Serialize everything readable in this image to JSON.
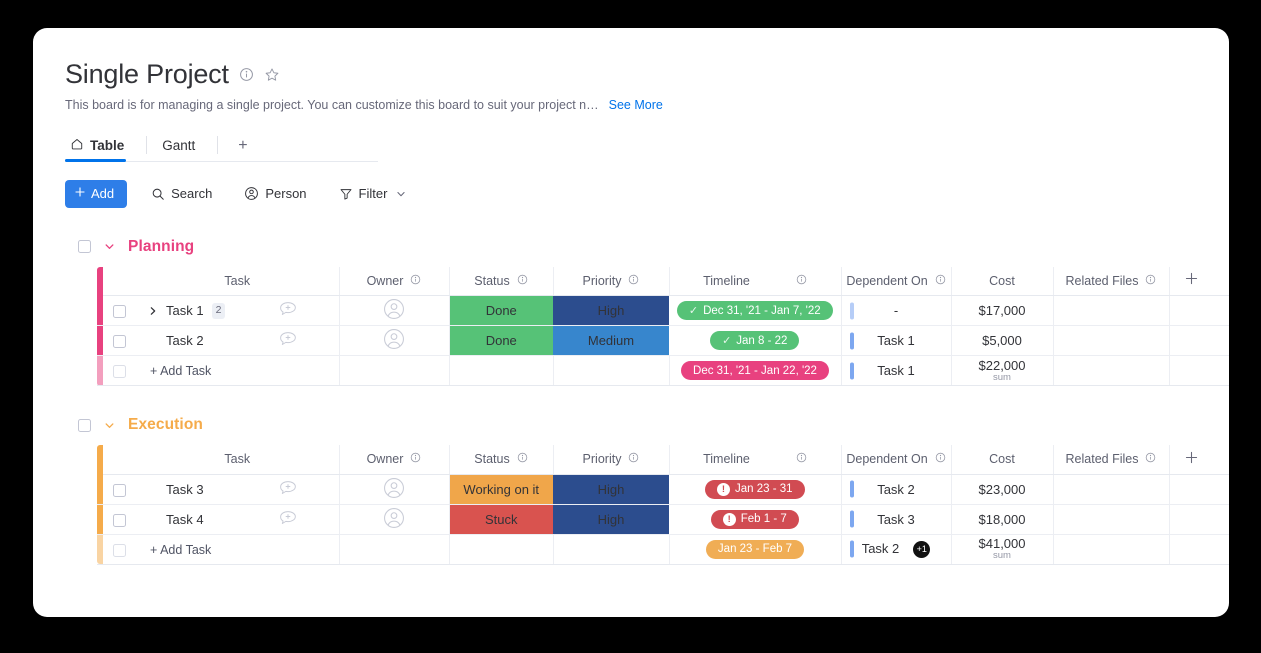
{
  "board": {
    "title": "Single Project",
    "description": "This board is for managing a single project. You can customize this board to suit your project n…",
    "see_more": "See More",
    "info_icon": "info-circle-icon",
    "star_icon": "star-outline-icon"
  },
  "tabs": {
    "items": [
      {
        "label": "Table",
        "icon": "home-icon",
        "active": true
      },
      {
        "label": "Gantt",
        "icon": "",
        "active": false
      }
    ],
    "add_label": "+"
  },
  "toolbar": {
    "add_label": "Add",
    "add_icon": "plus-icon",
    "search_label": "Search",
    "search_icon": "search-icon",
    "person_label": "Person",
    "person_icon": "person-icon",
    "filter_label": "Filter",
    "filter_icon": "funnel-icon",
    "chevron_icon": "chevron-down-icon"
  },
  "columns": [
    {
      "key": "task",
      "label": "Task",
      "info": false
    },
    {
      "key": "owner",
      "label": "Owner",
      "info": true
    },
    {
      "key": "status",
      "label": "Status",
      "info": true
    },
    {
      "key": "priority",
      "label": "Priority",
      "info": true
    },
    {
      "key": "timeline",
      "label": "Timeline",
      "info": true
    },
    {
      "key": "dependent",
      "label": "Dependent On",
      "info": true
    },
    {
      "key": "cost",
      "label": "Cost",
      "info": false
    },
    {
      "key": "files",
      "label": "Related Files",
      "info": true
    }
  ],
  "colors": {
    "accent_blue": "#0073ea",
    "add_button": "#2e7ee8",
    "group_planning": "#e8417f",
    "group_execution": "#f5ab4a",
    "status_done": "#56c277",
    "status_working": "#f0a64a",
    "status_stuck": "#d9534f",
    "priority_high": "#2c4d8e",
    "priority_medium": "#3786cd",
    "timeline_green": "#56c277",
    "timeline_pink": "#e8417f",
    "timeline_red": "#d14b52",
    "timeline_orange": "#f0ad55",
    "dep_bar_light": "#b6cdf7",
    "dep_bar_solid": "#7da7f0"
  },
  "groups": [
    {
      "name": "Planning",
      "color": "#e8417f",
      "caret_icon": "chevron-down-icon",
      "rows": [
        {
          "task": "Task 1",
          "expandable": true,
          "subitem_count": "2",
          "owner_icon": "avatar-placeholder-icon",
          "comment_icon": "comment-add-icon",
          "status": {
            "label": "Done",
            "color": "#56c277"
          },
          "priority": {
            "label": "High",
            "color": "#2c4d8e"
          },
          "timeline": {
            "label": "Dec 31, '21 - Jan 7, '22",
            "color": "#56c277",
            "icon": "check-icon"
          },
          "dependent": "-",
          "dep_bar": "#b6cdf7",
          "cost": "$17,000",
          "files": ""
        },
        {
          "task": "Task 2",
          "expandable": false,
          "subitem_count": "",
          "owner_icon": "avatar-placeholder-icon",
          "comment_icon": "comment-add-icon",
          "status": {
            "label": "Done",
            "color": "#56c277"
          },
          "priority": {
            "label": "Medium",
            "color": "#3786cd"
          },
          "timeline": {
            "label": "Jan 8 - 22",
            "color": "#56c277",
            "icon": "check-icon"
          },
          "dependent": "Task 1",
          "dep_bar": "#7da7f0",
          "cost": "$5,000",
          "files": ""
        }
      ],
      "footer": {
        "add_task_label": "+ Add Task",
        "timeline": {
          "label": "Dec 31, '21 - Jan 22, '22",
          "color": "#e8417f",
          "icon": ""
        },
        "dependent": "Task 1",
        "dep_bar": "#7da7f0",
        "extra_badge": "",
        "cost": "$22,000",
        "cost_sub": "sum"
      }
    },
    {
      "name": "Execution",
      "color": "#f5ab4a",
      "caret_icon": "chevron-down-icon",
      "rows": [
        {
          "task": "Task 3",
          "expandable": false,
          "subitem_count": "",
          "owner_icon": "avatar-placeholder-icon",
          "comment_icon": "comment-add-icon",
          "status": {
            "label": "Working on it",
            "color": "#f0a64a"
          },
          "priority": {
            "label": "High",
            "color": "#2c4d8e"
          },
          "timeline": {
            "label": "Jan 23 - 31",
            "color": "#d14b52",
            "icon": "alert-icon"
          },
          "dependent": "Task 2",
          "dep_bar": "#7da7f0",
          "cost": "$23,000",
          "files": ""
        },
        {
          "task": "Task 4",
          "expandable": false,
          "subitem_count": "",
          "owner_icon": "avatar-placeholder-icon",
          "comment_icon": "comment-add-icon",
          "status": {
            "label": "Stuck",
            "color": "#d9534f"
          },
          "priority": {
            "label": "High",
            "color": "#2c4d8e"
          },
          "timeline": {
            "label": "Feb 1 - 7",
            "color": "#d14b52",
            "icon": "alert-icon"
          },
          "dependent": "Task 3",
          "dep_bar": "#7da7f0",
          "cost": "$18,000",
          "files": ""
        }
      ],
      "footer": {
        "add_task_label": "+ Add Task",
        "timeline": {
          "label": "Jan 23 - Feb 7",
          "color": "#f0ad55",
          "icon": ""
        },
        "dependent": "Task 2",
        "dep_bar": "#7da7f0",
        "extra_badge": "+1",
        "cost": "$41,000",
        "cost_sub": "sum"
      }
    }
  ]
}
